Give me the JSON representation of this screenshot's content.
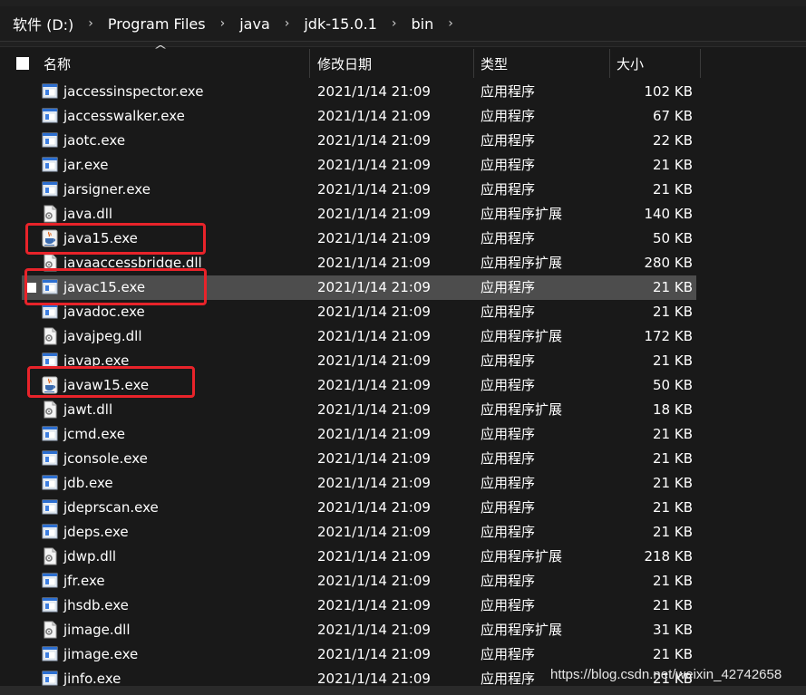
{
  "breadcrumb": {
    "items": [
      "软件 (D:)",
      "Program Files",
      "java",
      "jdk-15.0.1",
      "bin"
    ],
    "separator": "›"
  },
  "columns": {
    "name": "名称",
    "date": "修改日期",
    "type": "类型",
    "size": "大小"
  },
  "files": [
    {
      "name": "jaccessinspector.exe",
      "date": "2021/1/14 21:09",
      "type": "应用程序",
      "size": "102 KB",
      "icon": "exe-window-icon"
    },
    {
      "name": "jaccesswalker.exe",
      "date": "2021/1/14 21:09",
      "type": "应用程序",
      "size": "67 KB",
      "icon": "exe-window-icon"
    },
    {
      "name": "jaotc.exe",
      "date": "2021/1/14 21:09",
      "type": "应用程序",
      "size": "22 KB",
      "icon": "exe-window-icon"
    },
    {
      "name": "jar.exe",
      "date": "2021/1/14 21:09",
      "type": "应用程序",
      "size": "21 KB",
      "icon": "exe-window-icon"
    },
    {
      "name": "jarsigner.exe",
      "date": "2021/1/14 21:09",
      "type": "应用程序",
      "size": "21 KB",
      "icon": "exe-window-icon"
    },
    {
      "name": "java.dll",
      "date": "2021/1/14 21:09",
      "type": "应用程序扩展",
      "size": "140 KB",
      "icon": "dll-gear-icon"
    },
    {
      "name": "java15.exe",
      "date": "2021/1/14 21:09",
      "type": "应用程序",
      "size": "50 KB",
      "icon": "java-cup-icon"
    },
    {
      "name": "javaaccessbridge.dll",
      "date": "2021/1/14 21:09",
      "type": "应用程序扩展",
      "size": "280 KB",
      "icon": "dll-gear-icon"
    },
    {
      "name": "javac15.exe",
      "date": "2021/1/14 21:09",
      "type": "应用程序",
      "size": "21 KB",
      "icon": "exe-window-icon"
    },
    {
      "name": "javadoc.exe",
      "date": "2021/1/14 21:09",
      "type": "应用程序",
      "size": "21 KB",
      "icon": "exe-window-icon"
    },
    {
      "name": "javajpeg.dll",
      "date": "2021/1/14 21:09",
      "type": "应用程序扩展",
      "size": "172 KB",
      "icon": "dll-gear-icon"
    },
    {
      "name": "javap.exe",
      "date": "2021/1/14 21:09",
      "type": "应用程序",
      "size": "21 KB",
      "icon": "exe-window-icon"
    },
    {
      "name": "javaw15.exe",
      "date": "2021/1/14 21:09",
      "type": "应用程序",
      "size": "50 KB",
      "icon": "java-cup-icon"
    },
    {
      "name": "jawt.dll",
      "date": "2021/1/14 21:09",
      "type": "应用程序扩展",
      "size": "18 KB",
      "icon": "dll-gear-icon"
    },
    {
      "name": "jcmd.exe",
      "date": "2021/1/14 21:09",
      "type": "应用程序",
      "size": "21 KB",
      "icon": "exe-window-icon"
    },
    {
      "name": "jconsole.exe",
      "date": "2021/1/14 21:09",
      "type": "应用程序",
      "size": "21 KB",
      "icon": "exe-window-icon"
    },
    {
      "name": "jdb.exe",
      "date": "2021/1/14 21:09",
      "type": "应用程序",
      "size": "21 KB",
      "icon": "exe-window-icon"
    },
    {
      "name": "jdeprscan.exe",
      "date": "2021/1/14 21:09",
      "type": "应用程序",
      "size": "21 KB",
      "icon": "exe-window-icon"
    },
    {
      "name": "jdeps.exe",
      "date": "2021/1/14 21:09",
      "type": "应用程序",
      "size": "21 KB",
      "icon": "exe-window-icon"
    },
    {
      "name": "jdwp.dll",
      "date": "2021/1/14 21:09",
      "type": "应用程序扩展",
      "size": "218 KB",
      "icon": "dll-gear-icon"
    },
    {
      "name": "jfr.exe",
      "date": "2021/1/14 21:09",
      "type": "应用程序",
      "size": "21 KB",
      "icon": "exe-window-icon"
    },
    {
      "name": "jhsdb.exe",
      "date": "2021/1/14 21:09",
      "type": "应用程序",
      "size": "21 KB",
      "icon": "exe-window-icon"
    },
    {
      "name": "jimage.dll",
      "date": "2021/1/14 21:09",
      "type": "应用程序扩展",
      "size": "31 KB",
      "icon": "dll-gear-icon"
    },
    {
      "name": "jimage.exe",
      "date": "2021/1/14 21:09",
      "type": "应用程序",
      "size": "21 KB",
      "icon": "exe-window-icon"
    },
    {
      "name": "jinfo.exe",
      "date": "2021/1/14 21:09",
      "type": "应用程序",
      "size": "21 KB",
      "icon": "exe-window-icon"
    }
  ],
  "selected_file": "javac15.exe",
  "highlighted_files": [
    "java15.exe",
    "javac15.exe",
    "javaw15.exe"
  ],
  "watermark": "https://blog.csdn.net/weixin_42742658",
  "colors": {
    "background": "#191919",
    "selection": "#4d4d4d",
    "highlight": "#e8232a",
    "text": "#ffffff"
  }
}
